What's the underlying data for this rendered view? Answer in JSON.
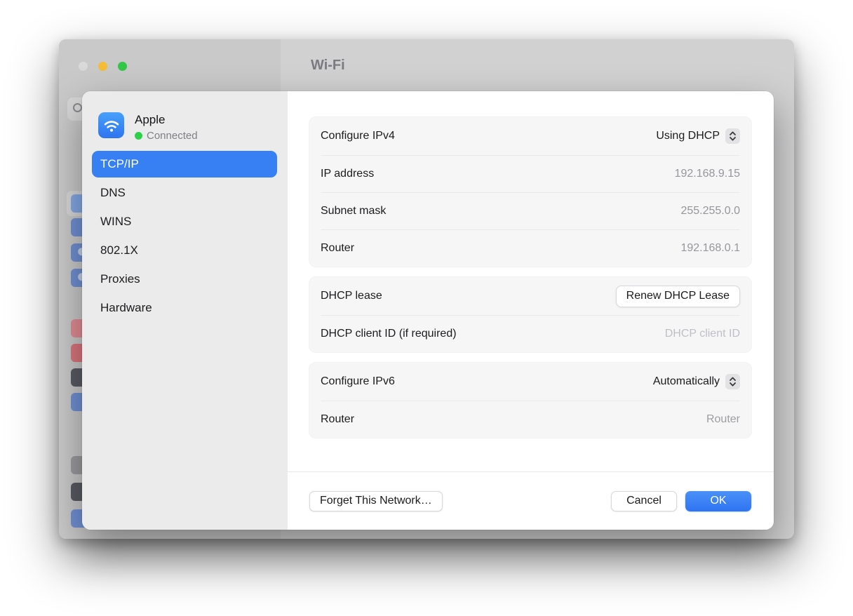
{
  "window": {
    "title": "Wi-Fi"
  },
  "sheet": {
    "network": {
      "name": "Apple",
      "status": "Connected"
    },
    "nav": [
      "TCP/IP",
      "DNS",
      "WINS",
      "802.1X",
      "Proxies",
      "Hardware"
    ],
    "nav_selected": "TCP/IP",
    "groups": [
      {
        "rows": [
          {
            "label": "Configure IPv4",
            "value": "Using DHCP"
          },
          {
            "label": "IP address",
            "value": "192.168.9.15"
          },
          {
            "label": "Subnet mask",
            "value": "255.255.0.0"
          },
          {
            "label": "Router",
            "value": "192.168.0.1"
          }
        ]
      },
      {
        "rows": [
          {
            "label": "DHCP lease",
            "button": "Renew DHCP Lease"
          },
          {
            "label": "DHCP client ID (if required)",
            "placeholder": "DHCP client ID"
          }
        ]
      },
      {
        "rows": [
          {
            "label": "Configure IPv6",
            "value": "Automatically"
          },
          {
            "label": "Router",
            "placeholder": "Router"
          }
        ]
      }
    ],
    "footer": {
      "forget": "Forget This Network…",
      "cancel": "Cancel",
      "ok": "OK"
    }
  },
  "colors": {
    "accent_selected": "#3780f4",
    "ok_button": "#2f74f2",
    "connected_green": "#2fd049",
    "traffic_yellow": "#f5bc38",
    "traffic_green": "#32c746",
    "value_gray": "#96969b"
  }
}
